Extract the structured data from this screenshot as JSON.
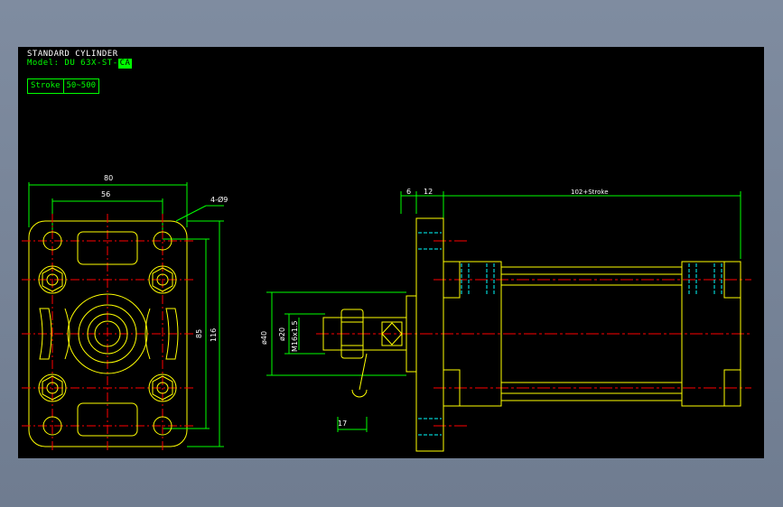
{
  "title_line": "STANDARD CYLINDER",
  "model_prefix": "Model: DU 63X-ST-",
  "model_suffix": "CA",
  "stroke_label": "Stroke",
  "stroke_range": "50~500",
  "front_view": {
    "overall_width": "80",
    "bolt_spacing_x": "56",
    "hole_callout": "4-Ø9",
    "bolt_spacing_y": "85",
    "overall_height": "116"
  },
  "side_view": {
    "flange_thickness": "6",
    "step_length": "12",
    "body_length": "102+Stroke",
    "diameter_40": "ø40",
    "diameter_20": "ø20",
    "thread": "M16x1.5",
    "wrench_flat": "17"
  },
  "colors": {
    "background": "#000000",
    "outline": "#ffff00",
    "dimension": "#00ff00",
    "centerline": "#ff0000",
    "hidden": "#00ffff",
    "text": "#ffffff"
  }
}
